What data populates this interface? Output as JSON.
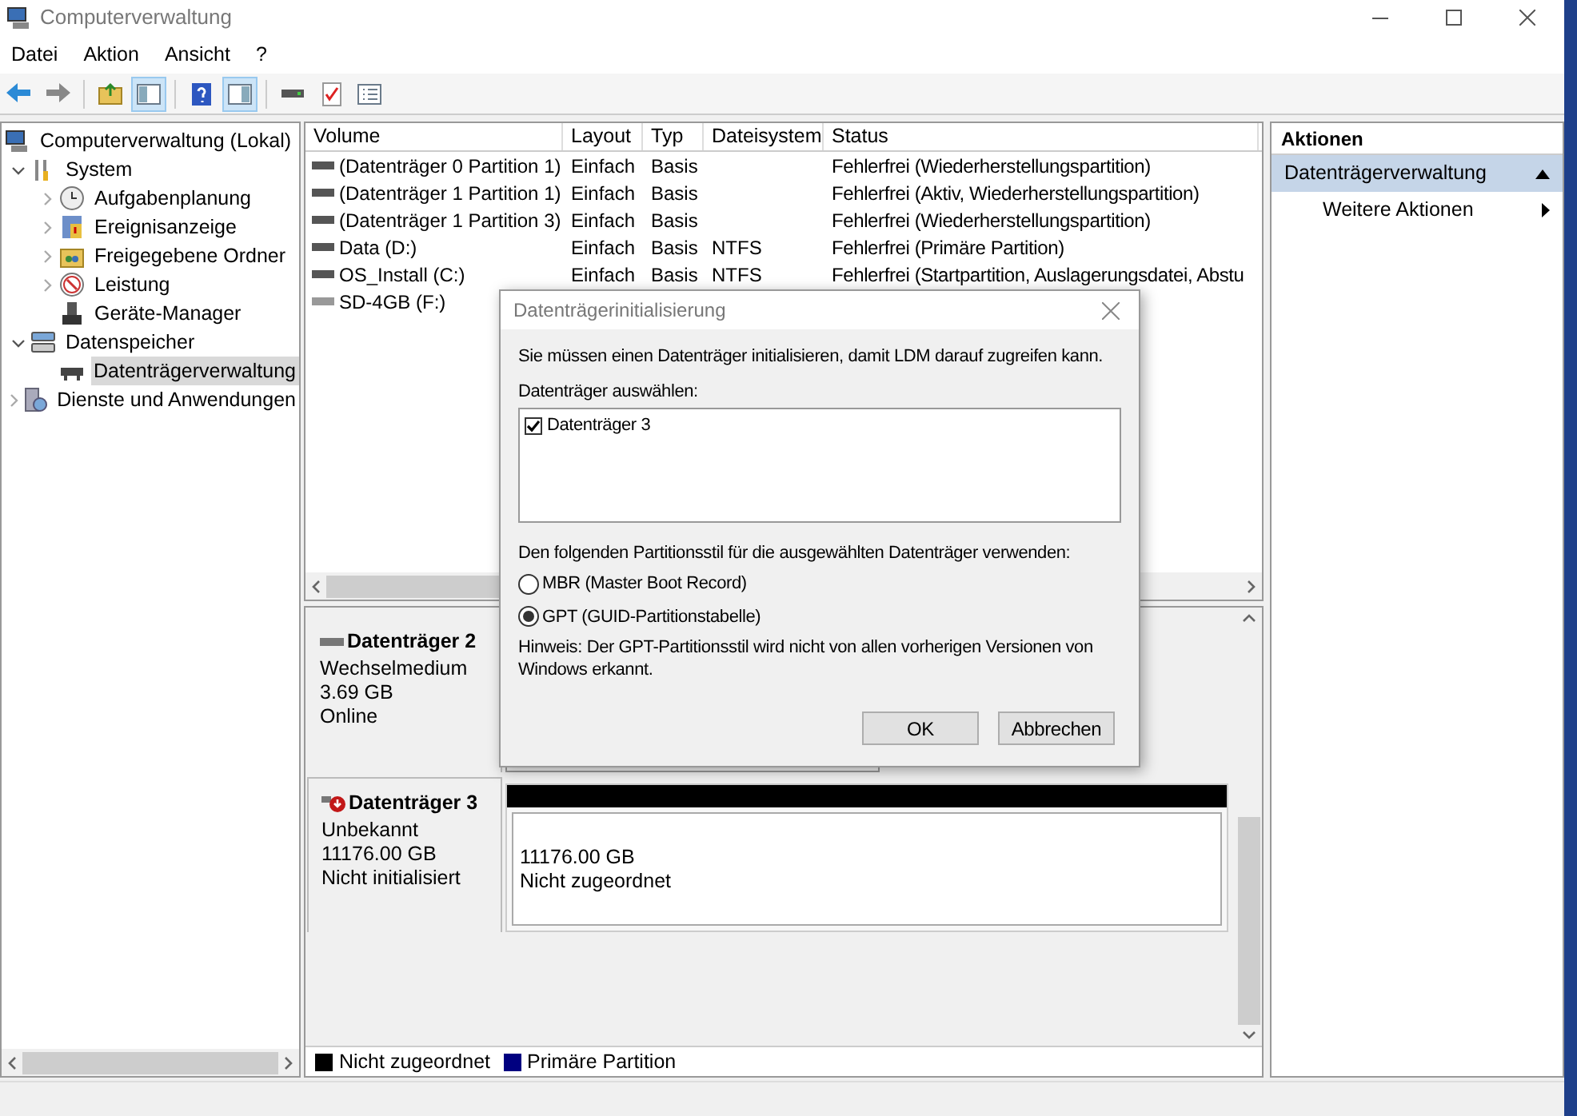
{
  "window": {
    "title": "Computerverwaltung"
  },
  "menu": [
    "Datei",
    "Aktion",
    "Ansicht",
    "?"
  ],
  "toolbar": [
    {
      "kind": "back",
      "active": false
    },
    {
      "kind": "forward",
      "active": false
    },
    {
      "kind": "folder",
      "active": false
    },
    {
      "kind": "tree",
      "active": true
    },
    {
      "kind": "help",
      "active": false
    },
    {
      "kind": "pane",
      "active": true
    },
    {
      "kind": "disk",
      "active": false
    },
    {
      "kind": "check",
      "active": false
    },
    {
      "kind": "list",
      "active": false
    }
  ],
  "tree": [
    {
      "label": "Computerverwaltung (Lokal)",
      "selected": false,
      "children": [
        {
          "label": "System",
          "expanded": true,
          "selected": false,
          "children": [
            {
              "label": "Aufgabenplanung",
              "expanded": false,
              "selected": false
            },
            {
              "label": "Ereignisanzeige",
              "expanded": false,
              "selected": false
            },
            {
              "label": "Freigegebene Ordner",
              "expanded": false,
              "selected": false
            },
            {
              "label": "Leistung",
              "expanded": false,
              "selected": false
            },
            {
              "label": "Geräte-Manager",
              "selected": false
            }
          ]
        },
        {
          "label": "Datenspeicher",
          "expanded": true,
          "selected": false,
          "children": [
            {
              "label": "Datenträgerverwaltung",
              "selected": true
            }
          ]
        },
        {
          "label": "Dienste und Anwendungen",
          "expanded": false,
          "selected": false
        }
      ]
    }
  ],
  "volumes": {
    "columns": [
      "Volume",
      "Layout",
      "Typ",
      "Dateisystem",
      "Status"
    ],
    "rows": [
      {
        "removable": false,
        "cells": [
          "(Datenträger 0 Partition 1)",
          "Einfach",
          "Basis",
          "",
          "Fehlerfrei (Wiederherstellungspartition)"
        ]
      },
      {
        "removable": false,
        "cells": [
          "(Datenträger 1 Partition 1)",
          "Einfach",
          "Basis",
          "",
          "Fehlerfrei (Aktiv, Wiederherstellungspartition)"
        ]
      },
      {
        "removable": false,
        "cells": [
          "(Datenträger 1 Partition 3)",
          "Einfach",
          "Basis",
          "",
          "Fehlerfrei (Wiederherstellungspartition)"
        ]
      },
      {
        "removable": false,
        "cells": [
          "Data (D:)",
          "Einfach",
          "Basis",
          "NTFS",
          "Fehlerfrei (Primäre Partition)"
        ]
      },
      {
        "removable": false,
        "cells": [
          "OS_Install (C:)",
          "Einfach",
          "Basis",
          "NTFS",
          "Fehlerfrei (Startpartition, Auslagerungsdatei, Abstu"
        ]
      },
      {
        "removable": true,
        "cells": [
          "SD-4GB (F:)",
          "",
          "",
          "",
          ""
        ]
      }
    ]
  },
  "disks": [
    {
      "name": "Datenträger 2",
      "type": "Wechselmedium",
      "size": "3.69 GB",
      "state": "Online",
      "error": false
    },
    {
      "name": "Datenträger 3",
      "type": "Unbekannt",
      "size": "11176.00 GB",
      "state": "Nicht initialisiert",
      "error": true,
      "partitions": [
        {
          "size": "11176.00 GB",
          "label": "Nicht zugeordnet",
          "color": "#000000"
        }
      ]
    }
  ],
  "legend": [
    {
      "label": "Nicht zugeordnet",
      "color": "#000000"
    },
    {
      "label": "Primäre Partition",
      "color": "#000080"
    }
  ],
  "actions": {
    "title": "Aktionen",
    "section": "Datenträgerverwaltung",
    "items": [
      "Weitere Aktionen"
    ]
  },
  "dialog": {
    "title": "Datenträgerinitialisierung",
    "message": "Sie müssen einen Datenträger initialisieren, damit LDM darauf zugreifen kann.",
    "list_label": "Datenträger auswählen:",
    "disks": [
      {
        "label": "Datenträger 3",
        "checked": true
      }
    ],
    "style_label": "Den folgenden Partitionsstil für die ausgewählten Datenträger verwenden:",
    "options": [
      {
        "label": "MBR (Master Boot Record)",
        "selected": false
      },
      {
        "label": "GPT (GUID-Partitionstabelle)",
        "selected": true
      }
    ],
    "note": "Hinweis: Der GPT-Partitionsstil wird nicht von allen vorherigen Versionen von Windows erkannt.",
    "buttons": [
      "OK",
      "Abbrechen"
    ]
  }
}
